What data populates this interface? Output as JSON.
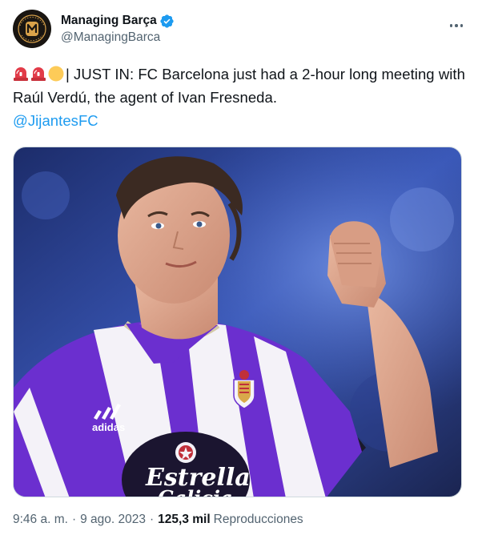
{
  "author": {
    "display_name": "Managing Barça",
    "handle": "@ManagingBarca",
    "verified": true,
    "avatar_lettering": "MANAGING BARÇA"
  },
  "tweet": {
    "emojis": [
      "rotating-light",
      "rotating-light",
      "yellow-circle"
    ],
    "text": "| JUST IN: FC Barcelona just had a 2-hour long meeting with Raúl Verdú, the agent of Ivan Fresneda.",
    "mention": "@JijantesFC"
  },
  "media": {
    "jersey_text_brand": "adidas",
    "jersey_text_sponsor": "Estrella",
    "jersey_text_sponsor_2": "Galicia"
  },
  "meta": {
    "time": "9:46 a. m.",
    "date": "9 ago. 2023",
    "views_count": "125,3 mil",
    "views_label": "Reproducciones"
  },
  "colors": {
    "accent": "#1d9bf0",
    "secondary_text": "#536471",
    "jersey_purple": "#6b2fcf"
  }
}
